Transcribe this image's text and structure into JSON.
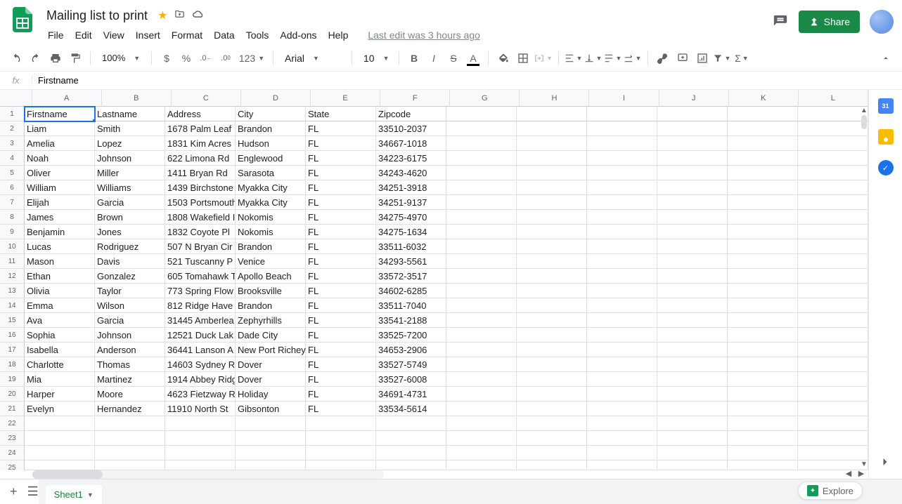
{
  "doc": {
    "title": "Mailing list to print",
    "edit_info": "Last edit was 3 hours ago"
  },
  "menu": [
    "File",
    "Edit",
    "View",
    "Insert",
    "Format",
    "Data",
    "Tools",
    "Add-ons",
    "Help"
  ],
  "share": {
    "label": "Share"
  },
  "toolbar": {
    "zoom": "100%",
    "font": "Arial",
    "font_size": "10",
    "number_format": "123"
  },
  "formula_bar": {
    "fx": "fx",
    "value": "Firstname"
  },
  "columns": [
    "A",
    "B",
    "C",
    "D",
    "E",
    "F",
    "G",
    "H",
    "I",
    "J",
    "K",
    "L"
  ],
  "row_numbers": [
    1,
    2,
    3,
    4,
    5,
    6,
    7,
    8,
    9,
    10,
    11,
    12,
    13,
    14,
    15,
    16,
    17,
    18,
    19,
    20,
    21,
    22,
    23,
    24,
    25
  ],
  "headers": [
    "Firstname",
    "Lastname",
    "Address",
    "City",
    "State",
    "Zipcode"
  ],
  "rows": [
    [
      "Liam",
      "Smith",
      "1678 Palm Leaf",
      "Brandon",
      "FL",
      "33510-2037"
    ],
    [
      "Amelia",
      "Lopez",
      "1831 Kim Acres",
      "Hudson",
      "FL",
      "34667-1018"
    ],
    [
      "Noah",
      "Johnson",
      "622 Limona Rd",
      "Englewood",
      "FL",
      "34223-6175"
    ],
    [
      "Oliver",
      "Miller",
      "1411 Bryan Rd",
      "Sarasota",
      "FL",
      "34243-4620"
    ],
    [
      "William",
      "Williams",
      "1439 Birchstone",
      "Myakka City",
      "FL",
      "34251-3918"
    ],
    [
      "Elijah",
      "Garcia",
      "1503 Portsmouth",
      "Myakka City",
      "FL",
      "34251-9137"
    ],
    [
      "James",
      "Brown",
      "1808 Wakefield I",
      "Nokomis",
      "FL",
      "34275-4970"
    ],
    [
      "Benjamin",
      "Jones",
      "1832 Coyote Pl",
      "Nokomis",
      "FL",
      "34275-1634"
    ],
    [
      "Lucas",
      "Rodriguez",
      "507 N Bryan Cir",
      "Brandon",
      "FL",
      "33511-6032"
    ],
    [
      "Mason",
      "Davis",
      "521 Tuscanny P",
      "Venice",
      "FL",
      "34293-5561"
    ],
    [
      "Ethan",
      "Gonzalez",
      "605 Tomahawk T",
      "Apollo Beach",
      "FL",
      "33572-3517"
    ],
    [
      "Olivia",
      "Taylor",
      "773 Spring Flow",
      "Brooksville",
      "FL",
      "34602-6285"
    ],
    [
      "Emma",
      "Wilson",
      "812 Ridge Have",
      "Brandon",
      "FL",
      "33511-7040"
    ],
    [
      "Ava",
      "Garcia",
      "31445 Amberlea",
      "Zephyrhills",
      "FL",
      "33541-2188"
    ],
    [
      "Sophia",
      "Johnson",
      "12521 Duck Lak",
      "Dade City",
      "FL",
      "33525-7200"
    ],
    [
      "Isabella",
      "Anderson",
      "36441 Lanson A",
      "New Port Richey",
      "FL",
      "34653-2906"
    ],
    [
      "Charlotte",
      "Thomas",
      "14603 Sydney R",
      "Dover",
      "FL",
      "33527-5749"
    ],
    [
      "Mia",
      "Martinez",
      "1914 Abbey Ridg",
      "Dover",
      "FL",
      "33527-6008"
    ],
    [
      "Harper",
      "Moore",
      "4623 Fietzway R",
      "Holiday",
      "FL",
      "34691-4731"
    ],
    [
      "Evelyn",
      "Hernandez",
      "11910 North St",
      "Gibsonton",
      "FL",
      "33534-5614"
    ]
  ],
  "footer": {
    "sheet_name": "Sheet1",
    "explore": "Explore"
  }
}
